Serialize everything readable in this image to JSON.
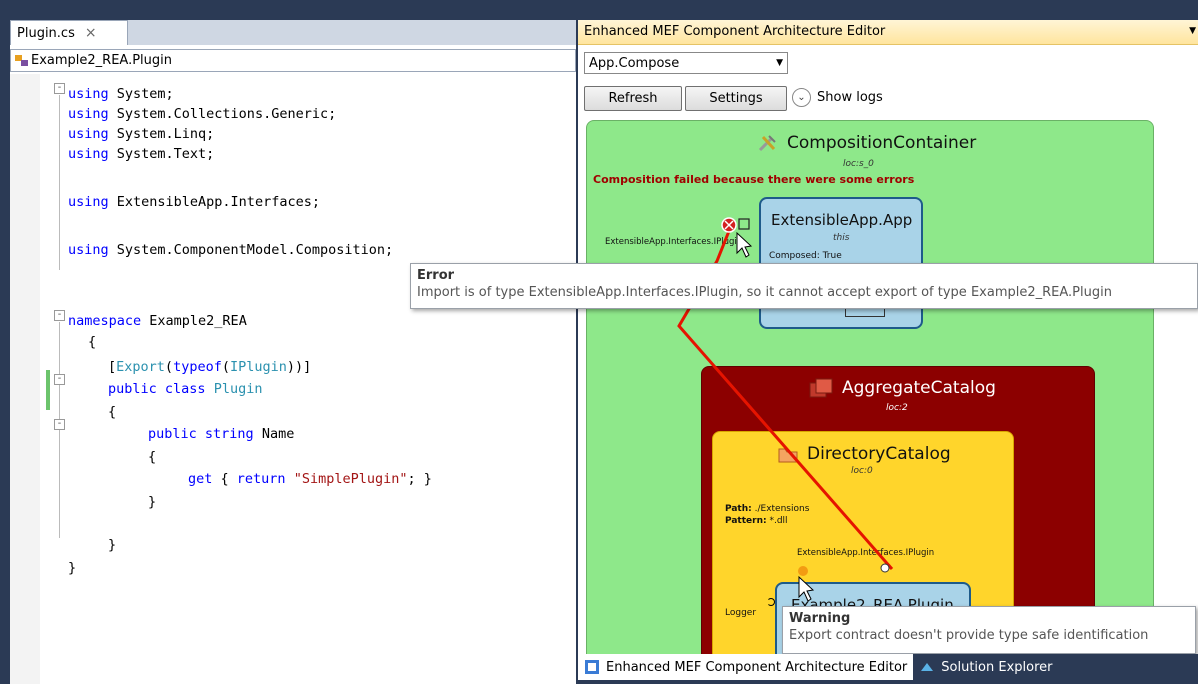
{
  "editor": {
    "file_tab": "Plugin.cs",
    "close_glyph": "×",
    "type_combo": "Example2_REA.Plugin",
    "code_lines": [
      {
        "parts": [
          [
            "kw",
            "using"
          ],
          [
            "",
            "System;"
          ]
        ]
      },
      {
        "parts": [
          [
            "kw",
            "using"
          ],
          [
            "",
            "System.Collections.Generic;"
          ]
        ]
      },
      {
        "parts": [
          [
            "kw",
            "using"
          ],
          [
            "",
            "System.Linq;"
          ]
        ]
      },
      {
        "parts": [
          [
            "kw",
            "using"
          ],
          [
            "",
            "System.Text;"
          ]
        ]
      },
      {
        "parts": [
          [
            "kw",
            "using"
          ],
          [
            "",
            "ExtensibleApp.Interfaces;"
          ]
        ]
      },
      {
        "parts": [
          [
            "kw",
            "using"
          ],
          [
            "",
            "System.ComponentModel.Composition;"
          ]
        ]
      },
      {
        "parts": [
          [
            "kw",
            "namespace"
          ],
          [
            "",
            "Example2_REA"
          ]
        ]
      },
      {
        "parts": [
          [
            "",
            "{"
          ]
        ]
      },
      {
        "parts": [
          [
            "",
            "["
          ],
          [
            "ty",
            "Export"
          ],
          [
            "",
            "("
          ],
          [
            "kw",
            "typeof"
          ],
          [
            "",
            "("
          ],
          [
            "ty",
            "IPlugin"
          ],
          [
            "",
            "))]"
          ]
        ]
      },
      {
        "parts": [
          [
            "kw",
            "public"
          ],
          [
            "kw",
            "class"
          ],
          [
            "ty",
            "Plugin"
          ]
        ]
      },
      {
        "parts": [
          [
            "",
            "{"
          ]
        ]
      },
      {
        "parts": [
          [
            "kw",
            "public"
          ],
          [
            "kw",
            "string"
          ],
          [
            "",
            "Name"
          ]
        ]
      },
      {
        "parts": [
          [
            "",
            "{"
          ]
        ]
      },
      {
        "parts": [
          [
            "kw",
            "get"
          ],
          [
            "",
            "{"
          ],
          [
            "kw",
            "return"
          ],
          [
            "st",
            "\"SimplePlugin\""
          ],
          [
            "",
            "; }"
          ]
        ]
      },
      {
        "parts": [
          [
            "",
            "}"
          ]
        ]
      },
      {
        "parts": [
          [
            "",
            "}"
          ]
        ]
      },
      {
        "parts": [
          [
            "",
            "}"
          ]
        ]
      }
    ]
  },
  "tool": {
    "title": "Enhanced MEF Component Architecture Editor",
    "compose_value": "App.Compose",
    "refresh_label": "Refresh",
    "settings_label": "Settings",
    "show_logs_label": "Show logs",
    "container": {
      "title": "CompositionContainer",
      "sub": "loc:s_0",
      "error": "Composition failed because there were some errors"
    },
    "app": {
      "title": "ExtensibleApp.App",
      "sub": "this",
      "composed": "Composed: True",
      "import_label": "ExtensibleApp.Interfaces.IPlugin"
    },
    "aggregate": {
      "title": "AggregateCatalog",
      "sub": "loc:2"
    },
    "dircat": {
      "title": "DirectoryCatalog",
      "sub": "loc:0",
      "path_label": "Path:",
      "path_value": "./Extensions",
      "pattern_label": "Pattern:",
      "pattern_value": "*.dll",
      "export_label": "ExtensibleApp.Interfaces.IPlugin"
    },
    "plugin": {
      "title": "Example2_REA.Plugin",
      "logger_label": "Logger"
    },
    "error_tip": {
      "head": "Error",
      "body": "Import is of type ExtensibleApp.Interfaces.IPlugin, so it cannot accept export of type Example2_REA.Plugin"
    },
    "warning_tip": {
      "head": "Warning",
      "body": "Export contract doesn't provide type safe identification"
    }
  },
  "bottom_tabs": {
    "mef": "Enhanced MEF Component Architecture Editor",
    "solution": "Solution Explorer"
  },
  "colors": {
    "container_fill": "#8ee88a",
    "part_fill": "#a9d3e8",
    "aggregate_fill": "#8c0000",
    "directory_fill": "#ffd52b",
    "connection_line": "#e51400",
    "error_text": "#a00000"
  }
}
